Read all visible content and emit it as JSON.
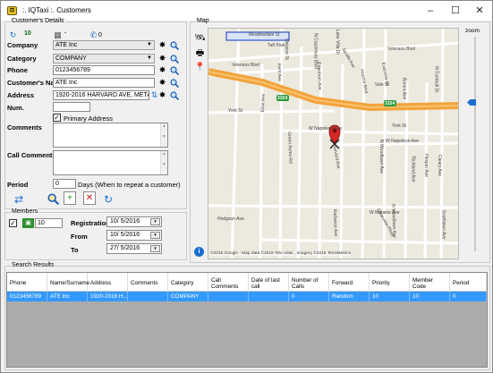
{
  "window": {
    "title": ":. IQTaxi :. Customers",
    "minimize": "–",
    "maximize": "☐",
    "close": "✕"
  },
  "customer_details": {
    "legend": "Customer's Details",
    "toolbar": {
      "count_a": "10",
      "count_b": "-",
      "count_c": "0"
    },
    "company": {
      "label": "Company",
      "value": "ATE Inc"
    },
    "category": {
      "label": "Category",
      "value": "COMPANY"
    },
    "phone": {
      "label": "Phone",
      "value": "0123456789"
    },
    "customer_name": {
      "label": "Customer's Name",
      "value": "ATE Inc"
    },
    "address": {
      "label": "Address",
      "value": "1920-2016 HARVARD AVE, METAIRIE,"
    },
    "num": {
      "label": "Num.",
      "value": ""
    },
    "primary_address": {
      "label": "Primary Address",
      "checked": true
    },
    "comments": {
      "label": "Comments"
    },
    "call_comments": {
      "label": "Call Comments"
    },
    "period": {
      "label": "Period",
      "value": "0",
      "hint": "Days (When to repeat a customer)"
    }
  },
  "members": {
    "legend": "Members",
    "checked": true,
    "count": "10",
    "registration": {
      "label": "Registration",
      "value": "10/ 5/2016"
    },
    "from": {
      "label": "From",
      "value": "10/ 5/2016"
    },
    "to": {
      "label": "To",
      "value": "27/ 5/2016"
    }
  },
  "map": {
    "legend": "Map",
    "zoom_label": "zoom",
    "attribution": "©2016 Google - Map data ©2016 Tele Atlas , Imagery ©2016 TerraMetrics",
    "streets": [
      "Meadowdale St",
      "Veterans Blvd",
      "Veterans Blvd",
      "York St",
      "York St",
      "W Napoleon Ave",
      "W Napoleon Ave",
      "W Metairie Ave",
      "Hodgson Ave",
      "Harvard Ave",
      "Kent Ave",
      "Elise Ave",
      "Edenborn Ave",
      "Green Acres Rd",
      "Division St",
      "Houma Blvd",
      "Clearview Pkwy",
      "N Turnbull Dr",
      "Hesper Ave",
      "Taft Park",
      "N Woodlawn Ave",
      "N Woodlawn Ave",
      "Radiance Ave",
      "Seville Ave",
      "Eastview Dr",
      "Richland Ave",
      "Cleary Ave",
      "Southlawn Ave",
      "Vale St",
      "Aurora Ave",
      "N Causeway Blvd",
      "Lake Villa Dr"
    ],
    "shields": [
      "3154",
      "3154"
    ]
  },
  "search_results": {
    "legend": "Search Results",
    "columns": [
      "Phone",
      "Name/Surname",
      "Address",
      "Comments",
      "Category",
      "Call Comments",
      "Date of last call",
      "Number of Calls",
      "Forward",
      "Priority",
      "Member Code",
      "Period"
    ],
    "rows": [
      [
        "0123456789",
        "ATE Inc",
        "1920-2016 H...",
        "",
        "COMPANY",
        "",
        "",
        "0",
        "Random",
        "10",
        "10",
        "0"
      ]
    ]
  },
  "colors": {
    "accent": "#3399ff",
    "highway": "#f3a33b",
    "pin": "#d62828"
  }
}
